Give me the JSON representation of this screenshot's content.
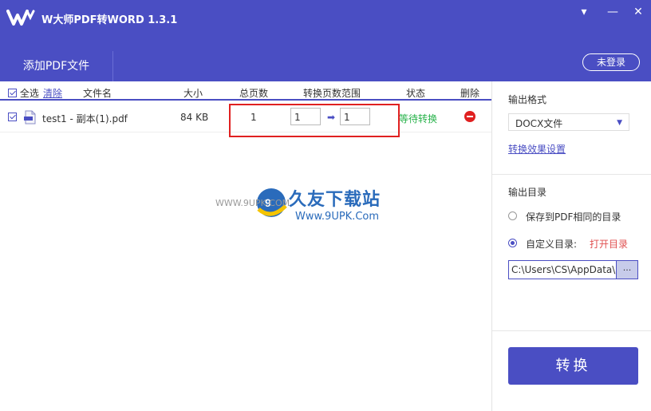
{
  "app": {
    "title": "W大师PDF转WORD 1.3.1"
  },
  "window": {
    "menu_glyph": "▾",
    "minimize_glyph": "—",
    "close_glyph": "✕"
  },
  "toolbar": {
    "add_pdf_label": "添加PDF文件",
    "login_label": "未登录"
  },
  "table": {
    "headers": {
      "select_all": "全选",
      "clear": "清除",
      "filename": "文件名",
      "size": "大小",
      "total_pages": "总页数",
      "range": "转换页数范围",
      "status": "状态",
      "delete": "删除"
    },
    "rows": [
      {
        "checked": true,
        "filename": "test1 - 副本(1).pdf",
        "size": "84 KB",
        "total_pages": "1",
        "range_from": "1",
        "range_to": "1",
        "status": "等待转换"
      }
    ]
  },
  "watermark": {
    "small": "WWW.9UPK.COM",
    "big": "久友下载站",
    "url": "Www.9UPK.Com"
  },
  "output_format": {
    "title": "输出格式",
    "selected": "DOCX文件",
    "settings_link": "转换效果设置"
  },
  "output_dir": {
    "title": "输出目录",
    "option_same": "保存到PDF相同的目录",
    "option_custom": "自定义目录:",
    "open_link": "打开目录",
    "path": "C:\\Users\\CS\\AppData\\l",
    "browse_label": "..."
  },
  "convert_label": "转换",
  "colors": {
    "accent": "#4a4ec3",
    "status_green": "#27b24a",
    "danger": "#e02020"
  },
  "icons": [
    "logo-icon",
    "menu-icon",
    "minimize-icon",
    "close-icon",
    "pdf-file-icon",
    "delete-icon",
    "dropdown-arrow-icon",
    "arrow-right-icon"
  ]
}
